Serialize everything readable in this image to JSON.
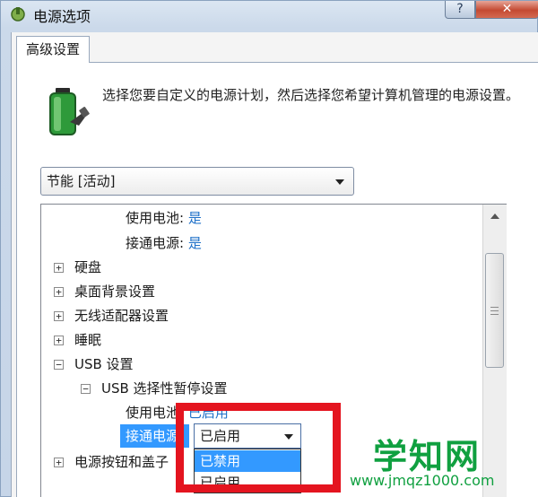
{
  "window": {
    "title": "电源选项",
    "help_label": "?",
    "close_label": "✕"
  },
  "tab": {
    "label": "高级设置"
  },
  "description": "选择您要自定义的电源计划，然后选择您希望计算机管理的电源设置。",
  "plan_select": {
    "value": "节能 [活动]"
  },
  "tree": {
    "battery_label": "使用电池:",
    "battery_value": "是",
    "plugged_label": "接通电源:",
    "plugged_value": "是",
    "hard_disk": "硬盘",
    "desktop_bg": "桌面背景设置",
    "wireless": "无线适配器设置",
    "sleep": "睡眠",
    "usb": "USB 设置",
    "usb_suspend": "USB 选择性暂停设置",
    "usb_battery_label": "使用电池:",
    "usb_battery_value": "已启用",
    "usb_plugged_label": "接通电源:",
    "power_buttons": "电源按钮和盖子",
    "expander_plus": "+",
    "expander_minus": "−"
  },
  "inline_select": {
    "value": "已启用",
    "options": [
      "已禁用",
      "已启用"
    ],
    "selected_index": 0
  },
  "watermark": {
    "cn": "学知网",
    "url": "www.jmqz1000.com"
  },
  "icons": [
    "app-power-icon",
    "battery-plug-icon",
    "chevron-down-icon",
    "scroll-up-icon"
  ],
  "colors": {
    "value_blue": "#1e70c8",
    "highlight_red": "#e4141f",
    "selection_blue": "#3399ff",
    "watermark_green": "#10a040"
  }
}
